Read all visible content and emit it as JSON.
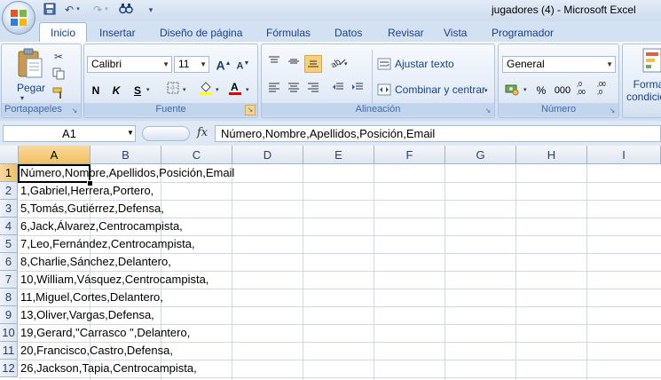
{
  "window": {
    "title": "jugadores (4)  -  Microsoft Excel"
  },
  "quick_access": {
    "icons": [
      "save-icon",
      "undo-icon",
      "redo-icon",
      "print-preview-icon",
      "customize-icon"
    ]
  },
  "tabs": [
    "Inicio",
    "Insertar",
    "Diseño de página",
    "Fórmulas",
    "Datos",
    "Revisar",
    "Vista",
    "Programador"
  ],
  "ribbon": {
    "clipboard": {
      "label": "Portapapeles",
      "paste": "Pegar"
    },
    "font": {
      "label": "Fuente",
      "name": "Calibri",
      "size": "11",
      "bold": "N",
      "italic": "K",
      "underline": "S"
    },
    "alignment": {
      "label": "Alineación",
      "wrap": "Ajustar texto",
      "merge": "Combinar y centrar"
    },
    "number": {
      "label": "Número",
      "format": "General",
      "percent": "%",
      "thousands": "000",
      "more_decimals": ",0\n,00",
      "fewer_decimals": ",00\n,0"
    },
    "styles": {
      "conditional": "Formato\ncondicional"
    }
  },
  "formula_bar": {
    "cell_ref": "A1",
    "fx": "fx",
    "content": "Número,Nombre,Apellidos,Posición,Email"
  },
  "columns": [
    "A",
    "B",
    "C",
    "D",
    "E",
    "F",
    "G",
    "H",
    "I"
  ],
  "rows": [
    {
      "n": "1",
      "a": "Número,Nombre,Apellidos,Posición,Email"
    },
    {
      "n": "2",
      "a": "1,Gabriel,Herrera,Portero,"
    },
    {
      "n": "3",
      "a": "5,Tomás,Gutiérrez,Defensa,"
    },
    {
      "n": "4",
      "a": "6,Jack,Álvarez,Centrocampista,"
    },
    {
      "n": "5",
      "a": "7,Leo,Fernández,Centrocampista,"
    },
    {
      "n": "6",
      "a": "8,Charlie,Sánchez,Delantero,"
    },
    {
      "n": "7",
      "a": "10,William,Vásquez,Centrocampista,"
    },
    {
      "n": "8",
      "a": "11,Miguel,Cortes,Delantero,"
    },
    {
      "n": "9",
      "a": "13,Oliver,Vargas,Defensa,"
    },
    {
      "n": "10",
      "a": "19,Gerard,\"Carrasco \",Delantero,"
    },
    {
      "n": "11",
      "a": "20,Francisco,Castro,Defensa,"
    },
    {
      "n": "12",
      "a": "26,Jackson,Tapia,Centrocampista,"
    }
  ]
}
